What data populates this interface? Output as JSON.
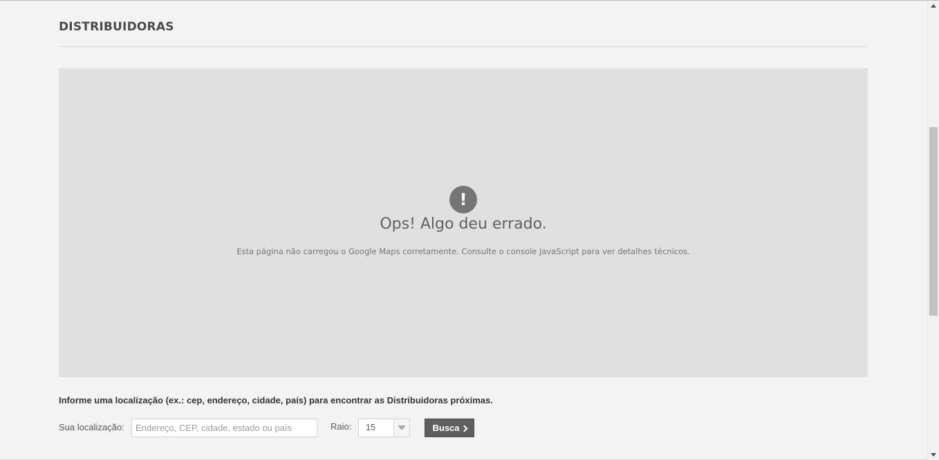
{
  "page": {
    "title": "DISTRIBUIDORAS"
  },
  "map": {
    "error_icon": "!",
    "error_title": "Ops! Algo deu errado.",
    "error_message": "Esta página não carregou o Google Maps corretamente. Consulte o console JavaScript para ver detalhes técnicos."
  },
  "search": {
    "instructions": "Informe uma localização (ex.: cep, endereço, cidade, país) para encontrar as Distribuidoras próximas.",
    "location_label": "Sua localização:",
    "location_placeholder": "Endereço, CEP, cidade, estado ou país",
    "location_value": "",
    "radius_label": "Raio:",
    "radius_value": "15",
    "button_label": "Busca"
  },
  "icons": {
    "error": "exclamation-circle-icon",
    "button": "chevron-right-icon",
    "dropdown": "chevron-down-icon"
  },
  "colors": {
    "background": "#f3f3f3",
    "map_placeholder": "#e0e0e0",
    "button": "#5f5f5f",
    "error_icon": "#757575"
  }
}
